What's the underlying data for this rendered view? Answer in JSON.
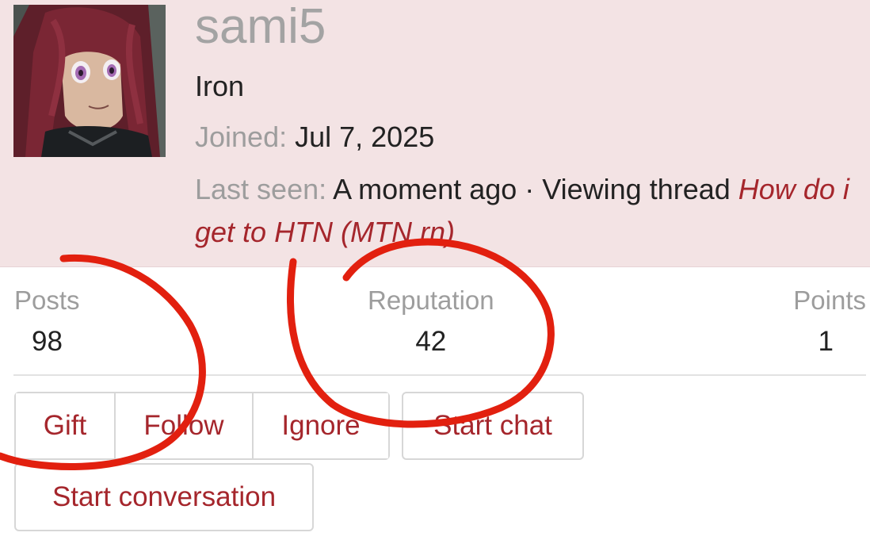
{
  "profile": {
    "username": "sami5",
    "rank": "Iron",
    "joined_label": "Joined:",
    "joined_value": "Jul 7, 2025",
    "last_seen_label": "Last seen:",
    "last_seen_value": "A moment ago · Viewing thread",
    "last_seen_thread": "How do i get to HTN (MTN rn)"
  },
  "stats": [
    {
      "label": "Posts",
      "value": "98"
    },
    {
      "label": "Reputation",
      "value": "42"
    },
    {
      "label": "Points",
      "value": "1"
    }
  ],
  "actions": {
    "gift": "Gift",
    "follow": "Follow",
    "ignore": "Ignore",
    "start_chat": "Start chat",
    "start_conversation": "Start conversation"
  },
  "colors": {
    "header_bg": "#f3e3e4",
    "accent": "#a5262c",
    "annotation": "#e2200f"
  },
  "icons": {
    "avatar": "anime-character-avatar"
  }
}
